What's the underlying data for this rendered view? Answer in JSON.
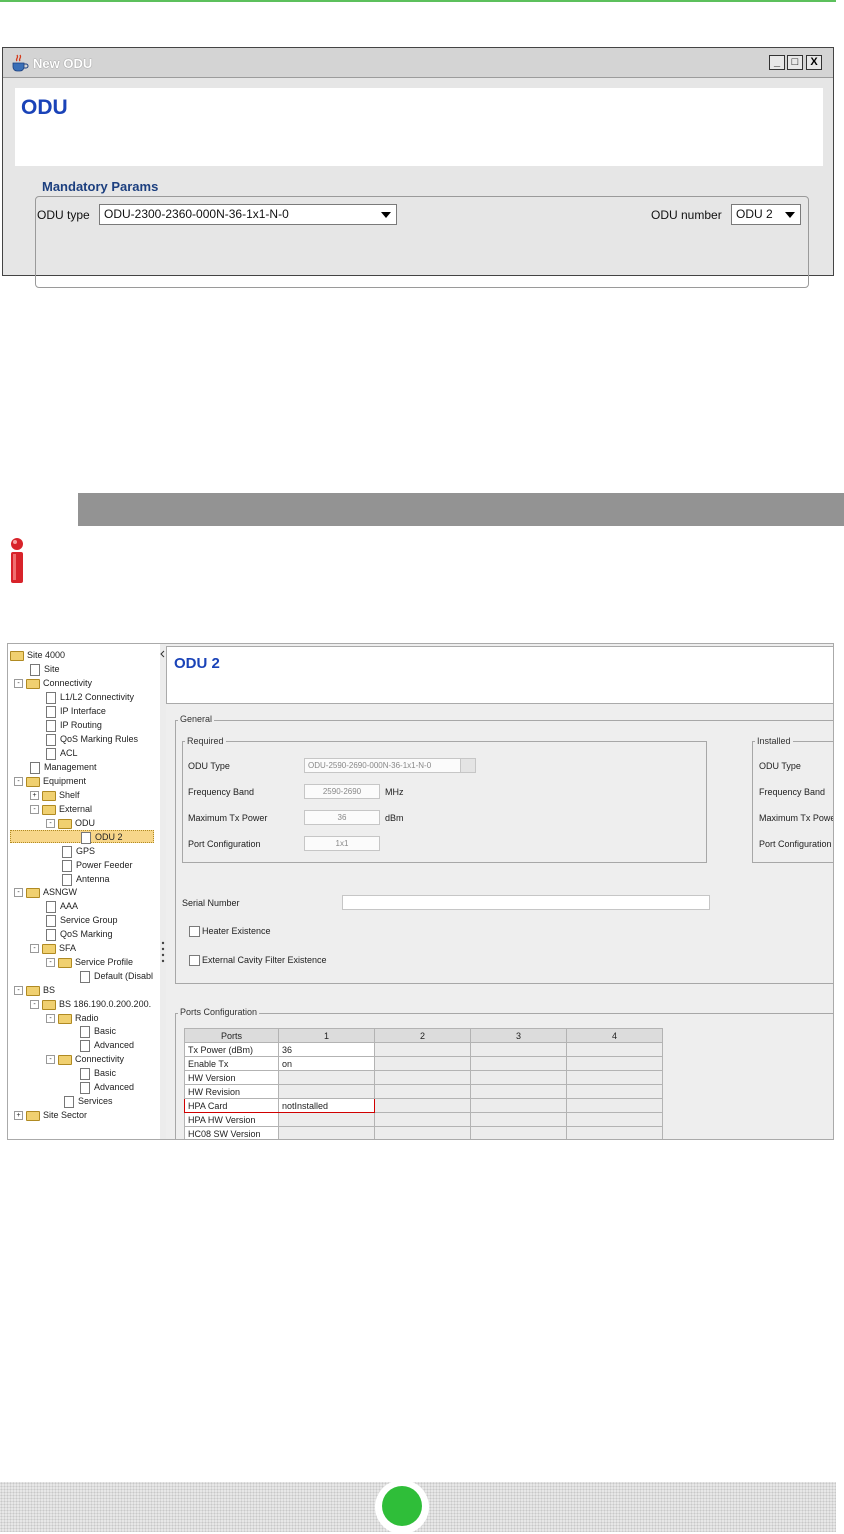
{
  "dialog": {
    "title": "New ODU",
    "header_title": "ODU",
    "section_title": "Mandatory Params",
    "odu_type_label": "ODU type",
    "odu_type_value": "ODU-2300-2360-000N-36-1x1-N-0",
    "odu_number_label": "ODU number",
    "odu_number_value": "ODU 2",
    "window_buttons": [
      "_",
      "□",
      "X"
    ]
  },
  "tree": {
    "items": [
      {
        "label": "Site 4000",
        "icon": "folder-open-icon"
      },
      {
        "label": "Site",
        "icon": "document-icon"
      },
      {
        "label": "Connectivity",
        "icon": "folder-open-icon"
      },
      {
        "label": "L1/L2 Connectivity",
        "icon": "document-icon"
      },
      {
        "label": "IP Interface",
        "icon": "document-icon"
      },
      {
        "label": "IP Routing",
        "icon": "document-icon"
      },
      {
        "label": "QoS Marking Rules",
        "icon": "document-icon"
      },
      {
        "label": "ACL",
        "icon": "document-icon"
      },
      {
        "label": "Management",
        "icon": "document-icon"
      },
      {
        "label": "Equipment",
        "icon": "folder-open-icon"
      },
      {
        "label": "Shelf",
        "icon": "folder-icon"
      },
      {
        "label": "External",
        "icon": "folder-open-icon"
      },
      {
        "label": "ODU",
        "icon": "folder-open-icon"
      },
      {
        "label": "ODU 2",
        "icon": "document-icon"
      },
      {
        "label": "GPS",
        "icon": "document-icon"
      },
      {
        "label": "Power Feeder",
        "icon": "document-icon"
      },
      {
        "label": "Antenna",
        "icon": "document-icon"
      },
      {
        "label": "ASNGW",
        "icon": "folder-open-icon"
      },
      {
        "label": "AAA",
        "icon": "document-icon"
      },
      {
        "label": "Service Group",
        "icon": "document-icon"
      },
      {
        "label": "QoS Marking",
        "icon": "document-icon"
      },
      {
        "label": "SFA",
        "icon": "folder-open-icon"
      },
      {
        "label": "Service Profile",
        "icon": "folder-open-icon"
      },
      {
        "label": "Default (Disabl",
        "icon": "document-icon"
      },
      {
        "label": "BS",
        "icon": "folder-open-icon"
      },
      {
        "label": "BS 186.190.0.200.200.",
        "icon": "folder-open-icon"
      },
      {
        "label": "Radio",
        "icon": "folder-open-icon"
      },
      {
        "label": "Basic",
        "icon": "document-icon"
      },
      {
        "label": "Advanced",
        "icon": "document-icon"
      },
      {
        "label": "Connectivity",
        "icon": "folder-open-icon"
      },
      {
        "label": "Basic",
        "icon": "document-icon"
      },
      {
        "label": "Advanced",
        "icon": "document-icon"
      },
      {
        "label": "Services",
        "icon": "document-icon"
      },
      {
        "label": "Site Sector",
        "icon": "folder-icon"
      }
    ]
  },
  "odu_panel": {
    "title": "ODU 2",
    "general_legend": "General",
    "required_legend": "Required",
    "installed_legend": "Installed",
    "fields": {
      "odu_type_label": "ODU Type",
      "odu_type_value": "ODU-2590-2690-000N-36-1x1-N-0",
      "frequency_band_label": "Frequency Band",
      "frequency_band_value": "2590-2690",
      "frequency_unit": "MHz",
      "max_tx_power_label": "Maximum Tx Power",
      "max_tx_power_value": "36",
      "power_unit": "dBm",
      "port_config_label": "Port Configuration",
      "port_config_value": "1x1"
    },
    "installed_fields": {
      "odu_type_label": "ODU Type",
      "frequency_band_label": "Frequency Band",
      "max_tx_power_label": "Maximum Tx Powe",
      "port_config_label": "Port Configuration"
    },
    "serial_number_label": "Serial Number",
    "serial_number_value": "",
    "heater_label": "Heater Existence",
    "cavity_filter_label": "External Cavity Filter Existence",
    "ports_legend": "Ports Configuration",
    "ports_table": {
      "headers": [
        "Ports",
        "1",
        "2",
        "3",
        "4"
      ],
      "rows": [
        [
          "Tx Power (dBm)",
          "36",
          "",
          "",
          ""
        ],
        [
          "Enable Tx",
          "on",
          "",
          "",
          ""
        ],
        [
          "HW Version",
          "",
          "",
          "",
          ""
        ],
        [
          "HW Revision",
          "",
          "",
          "",
          ""
        ],
        [
          "HPA Card",
          "notInstalled",
          "",
          "",
          ""
        ],
        [
          "HPA HW Version",
          "",
          "",
          "",
          ""
        ],
        [
          "HC08 SW Version",
          "",
          "",
          "",
          ""
        ]
      ]
    }
  },
  "colors": {
    "accent_blue": "#1a43b8",
    "rule_green": "#5cc05c",
    "footer_green": "#2fbe39",
    "highlight_red": "#d00000"
  }
}
